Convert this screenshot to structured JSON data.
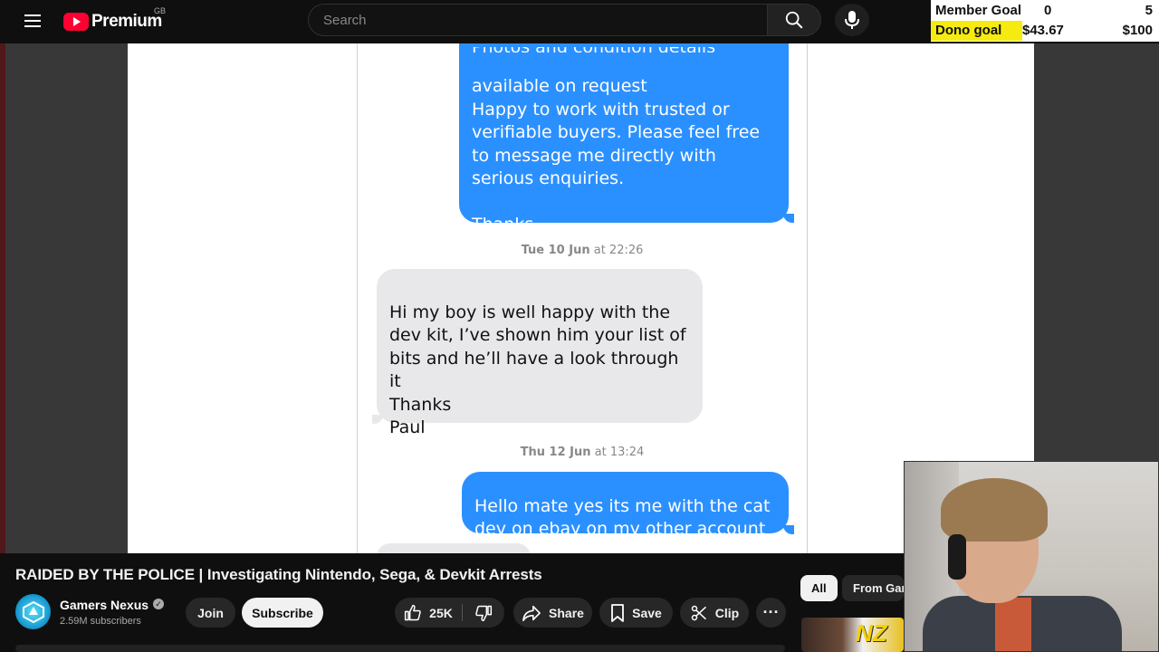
{
  "header": {
    "brand": "Premium",
    "region": "GB",
    "search_placeholder": "Search"
  },
  "goals": {
    "member_label": "Member Goal",
    "member_current": "0",
    "member_target": "5",
    "dono_label": "Dono goal",
    "dono_current": "$43.67",
    "dono_target": "$100",
    "dono_progress": 0.4367
  },
  "chat": {
    "bubble1_clipped": "Photos and condition details",
    "bubble1_text": "available on request\nHappy to work with trusted or\nverifiable buyers. Please feel free\nto message me directly with\nserious enquiries.\n\nThanks,",
    "timestamp1_day": "Tue 10 Jun",
    "timestamp1_time": "at 22:26",
    "bubble2_text": "Hi my boy is well happy with the\ndev kit, I’ve shown him your list of\nbits and he’ll have a look through\nit\nThanks\nPaul",
    "timestamp2_day": "Thu 12 Jun",
    "timestamp2_time": "at 13:24",
    "bubble3_text": "Hello mate yes its me with the cat\ndev on ebay on my other account"
  },
  "video": {
    "title": "RAIDED BY THE POLICE | Investigating Nintendo, Sega, & Devkit Arrests",
    "channel": "Gamers Nexus",
    "subscribers": "2.59M subscribers",
    "join_label": "Join",
    "subscribe_label": "Subscribe",
    "likes": "25K",
    "share_label": "Share",
    "save_label": "Save",
    "clip_label": "Clip"
  },
  "sidebar": {
    "chip_all": "All",
    "chip_from": "From Gamers Nexus",
    "thumb_text": "NZ"
  },
  "colors": {
    "sent_bubble": "#2b90ff",
    "recv_bubble": "#e8e8ea",
    "dono_highlight": "#f5eb10",
    "brand_red": "#ff0033"
  }
}
